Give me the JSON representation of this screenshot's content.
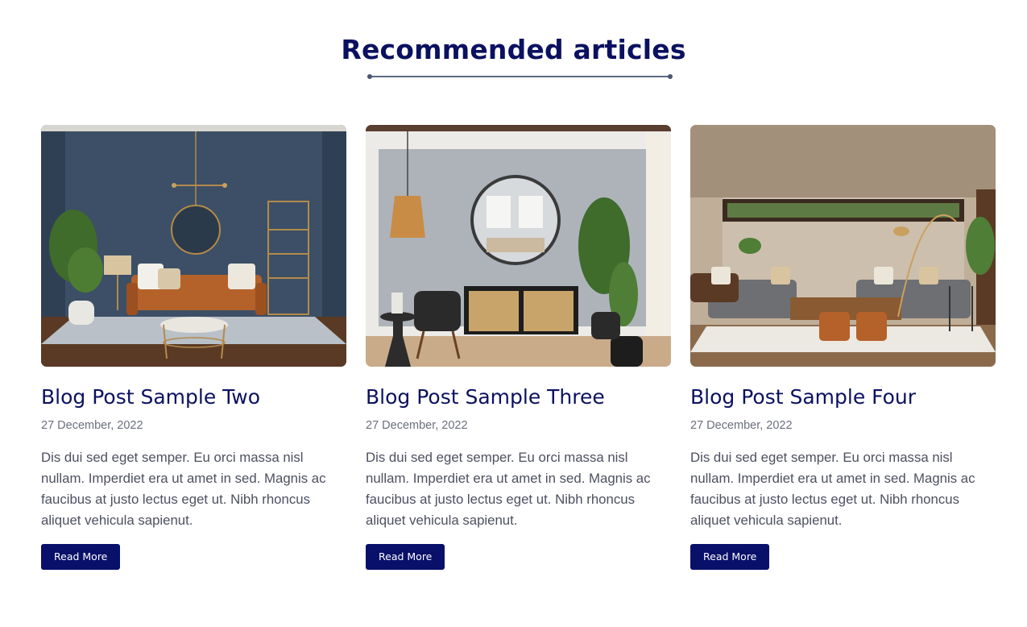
{
  "section": {
    "title": "Recommended articles"
  },
  "colors": {
    "heading": "#0b1160",
    "button_bg": "#08106a",
    "button_text": "#ffffff",
    "date_text": "#6b6f7e",
    "body_text": "#4d5060"
  },
  "articles": [
    {
      "title": "Blog Post Sample Two",
      "date": "27 December, 2022",
      "excerpt": "Dis dui sed eget semper. Eu orci massa nisl nullam. Imperdiet era ut amet in sed. Magnis ac faucibus at justo lectus eget ut. Nibh rhoncus aliquet vehicula sapienut.",
      "button_label": "Read More"
    },
    {
      "title": "Blog Post Sample Three",
      "date": "27 December, 2022",
      "excerpt": "Dis dui sed eget semper. Eu orci massa nisl nullam. Imperdiet era ut amet in sed. Magnis ac faucibus at justo lectus eget ut. Nibh rhoncus aliquet vehicula sapienut.",
      "button_label": "Read More"
    },
    {
      "title": "Blog Post Sample Four",
      "date": "27 December, 2022",
      "excerpt": "Dis dui sed eget semper. Eu orci massa nisl nullam. Imperdiet era ut amet in sed. Magnis ac faucibus at justo lectus eget ut. Nibh rhoncus aliquet vehicula sapienut.",
      "button_label": "Read More"
    }
  ]
}
